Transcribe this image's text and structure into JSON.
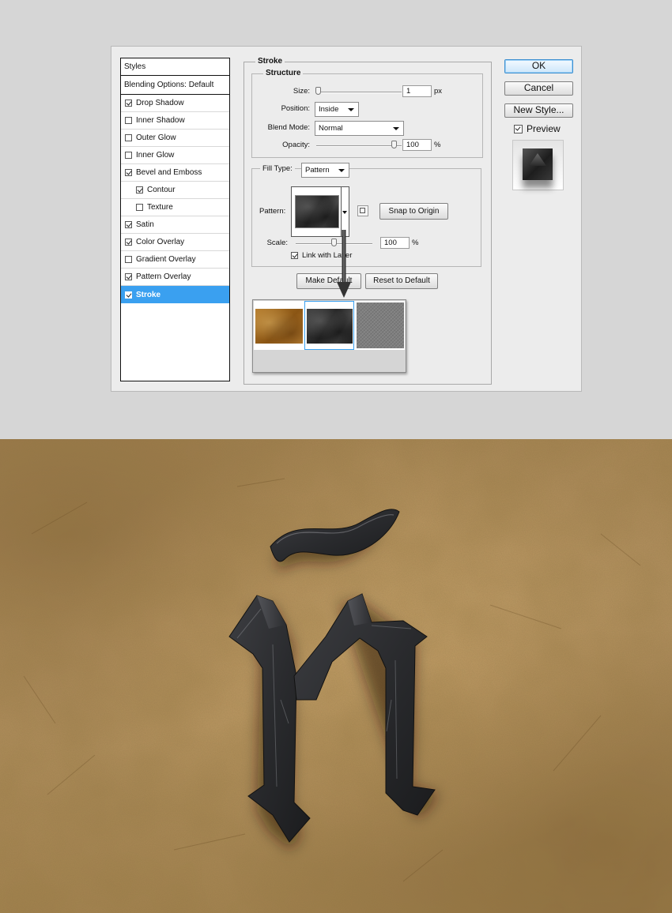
{
  "dialog": {
    "styles_list": {
      "header": "Styles",
      "blending": "Blending Options: Default",
      "items": [
        {
          "label": "Drop Shadow",
          "checked": true,
          "indent": false
        },
        {
          "label": "Inner Shadow",
          "checked": false,
          "indent": false
        },
        {
          "label": "Outer Glow",
          "checked": false,
          "indent": false
        },
        {
          "label": "Inner Glow",
          "checked": false,
          "indent": false
        },
        {
          "label": "Bevel and Emboss",
          "checked": true,
          "indent": false
        },
        {
          "label": "Contour",
          "checked": true,
          "indent": true
        },
        {
          "label": "Texture",
          "checked": false,
          "indent": true
        },
        {
          "label": "Satin",
          "checked": true,
          "indent": false
        },
        {
          "label": "Color Overlay",
          "checked": true,
          "indent": false
        },
        {
          "label": "Gradient Overlay",
          "checked": false,
          "indent": false
        },
        {
          "label": "Pattern Overlay",
          "checked": true,
          "indent": false
        },
        {
          "label": "Stroke",
          "checked": true,
          "indent": false,
          "selected": true
        }
      ]
    },
    "stroke": {
      "title": "Stroke",
      "structure_title": "Structure",
      "size_label": "Size:",
      "size_value": "1",
      "size_unit": "px",
      "position_label": "Position:",
      "position_value": "Inside",
      "blend_mode_label": "Blend Mode:",
      "blend_mode_value": "Normal",
      "opacity_label": "Opacity:",
      "opacity_value": "100",
      "opacity_unit": "%",
      "fill_type_label": "Fill Type:",
      "fill_type_value": "Pattern",
      "pattern_label": "Pattern:",
      "snap_label": "Snap to Origin",
      "scale_label": "Scale:",
      "scale_value": "100",
      "scale_unit": "%",
      "link_label": "Link with Layer",
      "link_checked": true,
      "make_default_label": "Make Default",
      "reset_default_label": "Reset to Default"
    },
    "pattern_picker": {
      "patterns": [
        "leather-texture",
        "dark-grunge-texture",
        "gray-noise-texture"
      ],
      "selected_index": 1
    },
    "buttons": {
      "ok": "OK",
      "cancel": "Cancel",
      "new_style": "New Style...",
      "preview": "Preview",
      "preview_checked": true
    }
  },
  "artwork": {
    "letter": "ñ",
    "background": "aged-parchment-texture",
    "letter_style": "dark-stone-blackletter"
  },
  "colors": {
    "selection_blue": "#3aa0f0",
    "dialog_bg": "#ececec",
    "parchment": "#b89563",
    "stone": "#2f3033"
  }
}
